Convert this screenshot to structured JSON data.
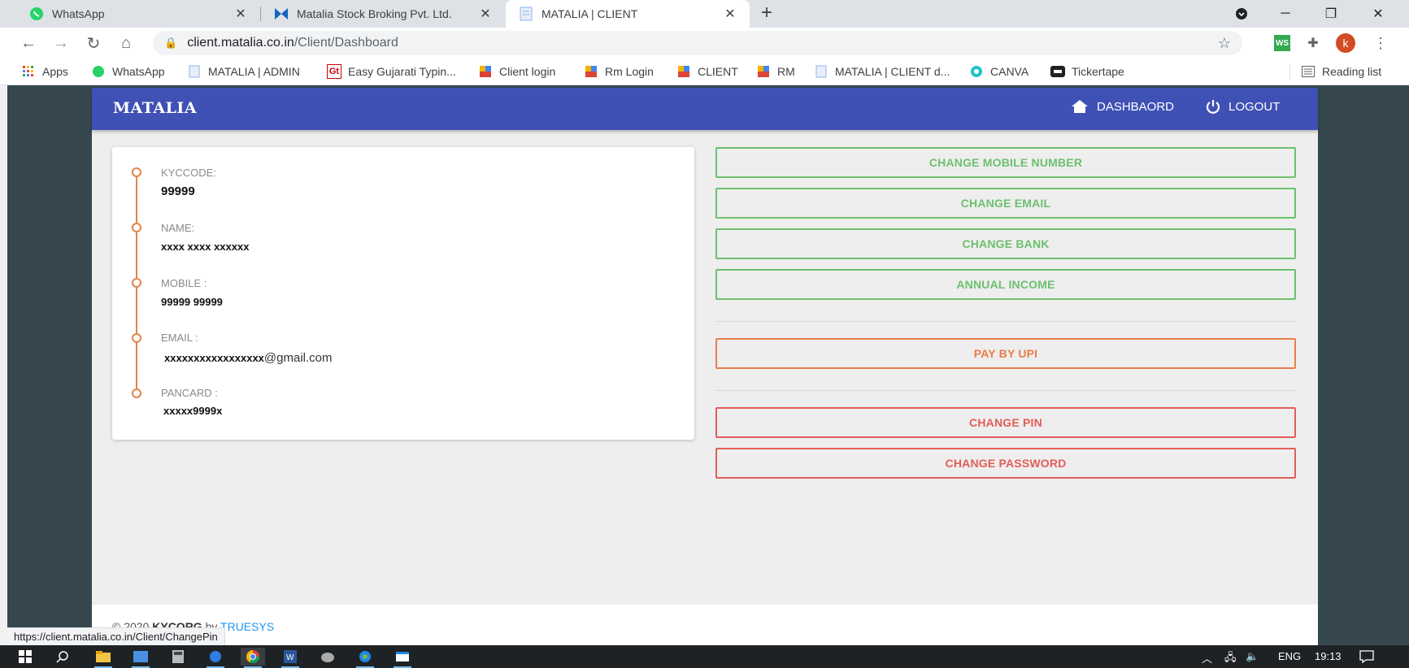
{
  "browser": {
    "tabs": [
      {
        "title": "WhatsApp",
        "active": false
      },
      {
        "title": "Matalia Stock Broking Pvt. Ltd.",
        "active": false
      },
      {
        "title": "MATALIA | CLIENT",
        "active": true
      }
    ],
    "address": {
      "host": "client.matalia.co.in",
      "path": "/Client/Dashboard"
    },
    "bookmarks": [
      "Apps",
      "WhatsApp",
      "MATALIA | ADMIN",
      "Easy Gujarati Typin...",
      "Client login",
      "Rm Login",
      "CLIENT",
      "RM",
      "MATALIA | CLIENT d...",
      "CANVA",
      "Tickertape"
    ],
    "reading_list": "Reading list",
    "profile_initial": "k",
    "ext_ws": "WS",
    "status_url": "https://client.matalia.co.in/Client/ChangePin"
  },
  "site": {
    "brand": "MATALIA",
    "nav": {
      "dashboard": "DASHBAORD",
      "logout": "LOGOUT"
    },
    "profile": {
      "kyc_label": "KYCCODE:",
      "kyc_value": "99999",
      "name_label": "NAME:",
      "name_value": "xxxx xxxx xxxxxx",
      "mobile_label": "MOBILE :",
      "mobile_value": "99999 99999",
      "email_label": "EMAIL :",
      "email_user": "xxxxxxxxxxxxxxxxx",
      "email_domain": "@gmail.com",
      "pan_label": "PANCARD :",
      "pan_value": "xxxxx9999x"
    },
    "actions": {
      "change_mobile": "CHANGE MOBILE NUMBER",
      "change_email": "CHANGE EMAIL",
      "change_bank": "CHANGE BANK",
      "annual_income": "ANNUAL INCOME",
      "pay_upi": "PAY BY UPI",
      "change_pin": "CHANGE PIN",
      "change_password": "CHANGE PASSWORD"
    },
    "footer": {
      "copyright": "© 2020",
      "org": "KYCORG",
      "by": "by",
      "vendor": "TRUESYS"
    }
  },
  "taskbar": {
    "language": "ENG",
    "time": "19:13"
  },
  "colors": {
    "header": "#3f51b5",
    "green": "#6cc06f",
    "orange": "#ea7d4a",
    "red": "#e35d57",
    "timeline": "#e0844a"
  }
}
